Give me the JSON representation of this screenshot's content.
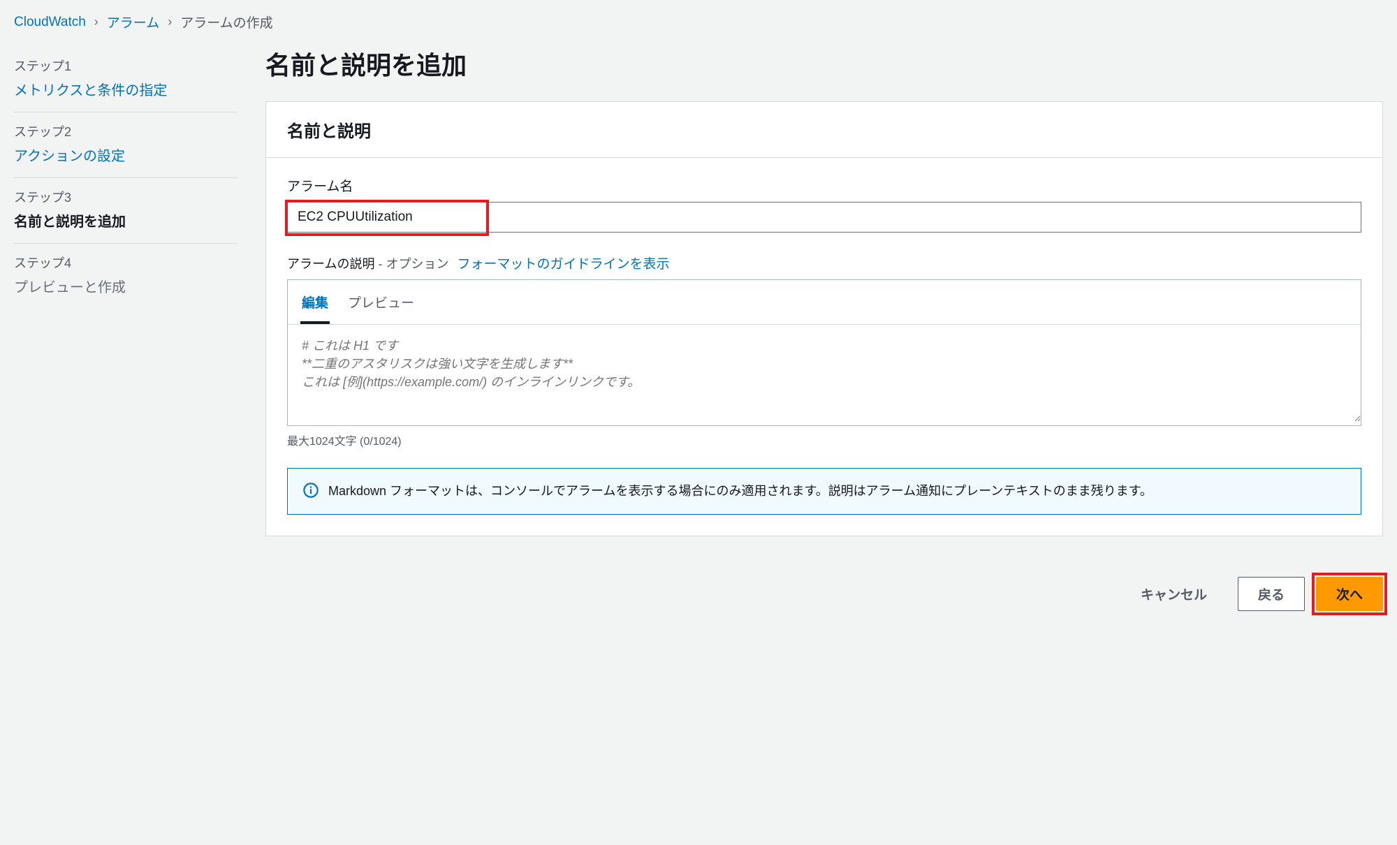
{
  "breadcrumb": {
    "root": "CloudWatch",
    "alarms": "アラーム",
    "current": "アラームの作成"
  },
  "steps": [
    {
      "label": "ステップ1",
      "title": "メトリクスと条件の指定",
      "state": "link"
    },
    {
      "label": "ステップ2",
      "title": "アクションの設定",
      "state": "link"
    },
    {
      "label": "ステップ3",
      "title": "名前と説明を追加",
      "state": "active"
    },
    {
      "label": "ステップ4",
      "title": "プレビューと作成",
      "state": "muted"
    }
  ],
  "page_title": "名前と説明を追加",
  "panel": {
    "header": "名前と説明",
    "alarm_name_label": "アラーム名",
    "alarm_name_value": "EC2 CPUUtilization",
    "desc_label": "アラームの説明",
    "desc_opt": "- オプション",
    "guideline_link": "フォーマットのガイドラインを表示",
    "tabs": {
      "edit": "編集",
      "preview": "プレビュー"
    },
    "desc_placeholder": "# これは H1 です\n**二重のアスタリスクは強い文字を生成します**\nこれは [例](https://example.com/) のインラインリンクです。",
    "char_count": "最大1024文字 (0/1024)",
    "info_text": "Markdown フォーマットは、コンソールでアラームを表示する場合にのみ適用されます。説明はアラーム通知にプレーンテキストのまま残ります。"
  },
  "actions": {
    "cancel": "キャンセル",
    "back": "戻る",
    "next": "次へ"
  }
}
